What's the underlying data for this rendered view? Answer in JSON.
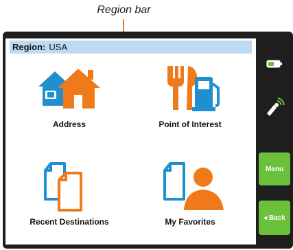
{
  "callout": {
    "label": "Region bar"
  },
  "region_bar": {
    "label": "Region:",
    "value": "USA"
  },
  "tiles": [
    {
      "label": "Address",
      "icon": "address-houses-icon"
    },
    {
      "label": "Point of Interest",
      "icon": "point-of-interest-icon"
    },
    {
      "label": "Recent Destinations",
      "icon": "recent-destinations-icon"
    },
    {
      "label": "My Favorites",
      "icon": "my-favorites-icon"
    }
  ],
  "sidebar": {
    "battery_icon": "battery-icon",
    "gps_icon": "gps-satellite-icon",
    "menu_label": "Menu",
    "back_label": "◂ Back"
  },
  "colors": {
    "accent_orange": "#f07a1a",
    "accent_blue": "#1f8fd0",
    "region_bar_bg": "#bfdaf3",
    "sidebar_green": "#6cc13a",
    "device_dark": "#1e1e1e"
  }
}
